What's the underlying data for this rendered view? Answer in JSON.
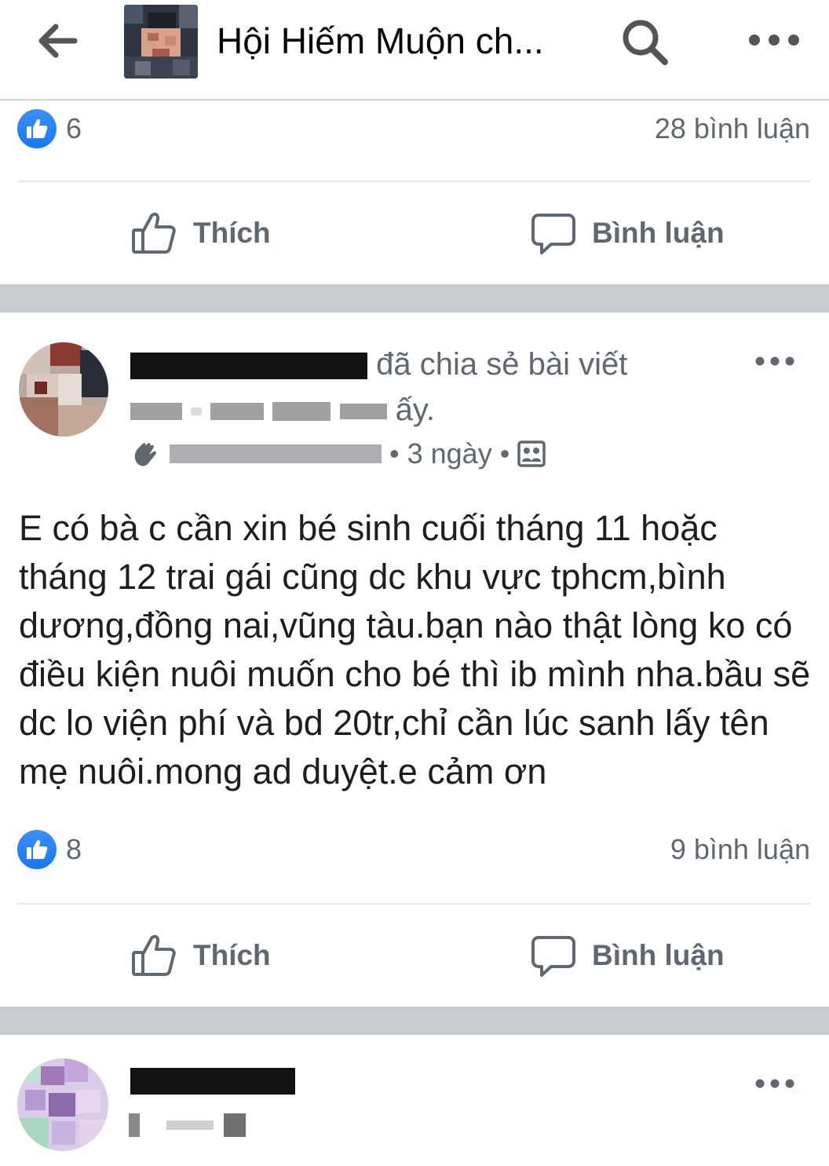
{
  "topbar": {
    "title": "Hội Hiếm Muộn ch...",
    "back_icon": "arrow-left-icon",
    "search_icon": "search-icon",
    "more_icon": "more-horizontal-icon"
  },
  "prev_post": {
    "like_count": "6",
    "comment_count": "28 bình luận",
    "like_label": "Thích",
    "comment_label": "Bình luận"
  },
  "post": {
    "shared_text": "đã chia sẻ bài viết",
    "shared_text_end": "ấy.",
    "meta_time": "• 3 ngày •",
    "body": "E có bà c cần xin bé sinh cuối tháng 11 hoặc tháng 12 trai gái cũng dc khu vực tphcm,bình dương,đồng nai,vũng tàu.bạn nào thật lòng ko có điều kiện nuôi muốn cho bé thì ib mình nha.bầu sẽ dc lo viện phí và bd 20tr,chỉ cần lúc sanh lấy tên mẹ nuôi.mong ad duyệt.e cảm ơn",
    "like_count": "8",
    "comment_count": "9 bình luận",
    "like_label": "Thích",
    "comment_label": "Bình luận"
  },
  "colors": {
    "accent": "#1877f2",
    "secondary_text": "#606770",
    "separator": "#c9ccd1"
  }
}
